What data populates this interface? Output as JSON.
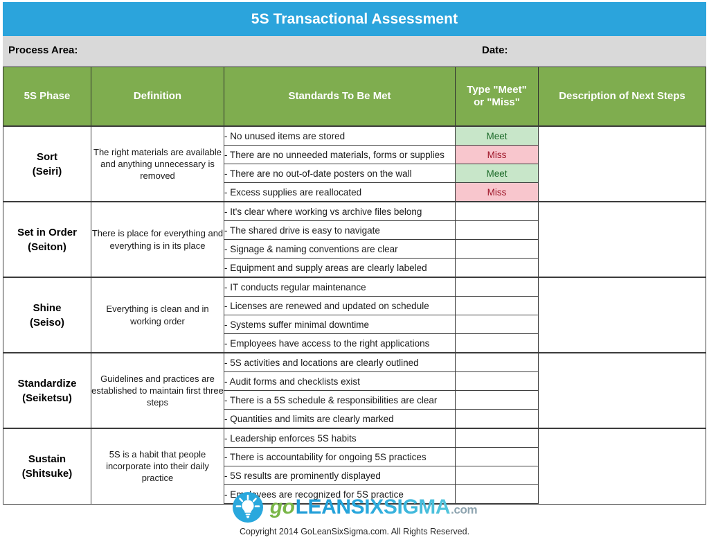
{
  "header": {
    "title": "5S Transactional Assessment"
  },
  "meta": {
    "process_area_label": "Process Area:",
    "process_area_value": "",
    "date_label": "Date:",
    "date_value": ""
  },
  "table": {
    "columns": [
      "5S Phase",
      "Definition",
      "Standards To Be Met",
      "Type \"Meet\" or \"Miss\"",
      "Description of Next Steps"
    ],
    "column_type_line1": "Type \"Meet\"",
    "column_type_line2": "or \"Miss\"",
    "sections": [
      {
        "phase_line1": "Sort",
        "phase_line2": "(Seiri)",
        "definition": "The right materials are available and anything unnecessary is removed",
        "rows": [
          {
            "standard": "- No unused items are stored",
            "type": "Meet",
            "next_steps": ""
          },
          {
            "standard": "- There are no unneeded materials, forms or supplies",
            "type": "Miss",
            "next_steps": ""
          },
          {
            "standard": "- There are no out-of-date posters on the wall",
            "type": "Meet",
            "next_steps": ""
          },
          {
            "standard": "- Excess supplies are reallocated",
            "type": "Miss",
            "next_steps": ""
          }
        ]
      },
      {
        "phase_line1": "Set in Order",
        "phase_line2": "(Seiton)",
        "definition": "There is place for everything and everything is in its place",
        "rows": [
          {
            "standard": "- It's clear where working vs archive files belong",
            "type": "",
            "next_steps": ""
          },
          {
            "standard": "- The shared drive is easy to navigate",
            "type": "",
            "next_steps": ""
          },
          {
            "standard": "- Signage & naming conventions are clear",
            "type": "",
            "next_steps": ""
          },
          {
            "standard": "- Equipment and supply areas are clearly labeled",
            "type": "",
            "next_steps": ""
          }
        ]
      },
      {
        "phase_line1": "Shine",
        "phase_line2": "(Seiso)",
        "definition": "Everything is clean and in working order",
        "rows": [
          {
            "standard": "- IT conducts regular maintenance",
            "type": "",
            "next_steps": ""
          },
          {
            "standard": "- Licenses are renewed and updated on schedule",
            "type": "",
            "next_steps": ""
          },
          {
            "standard": "- Systems suffer minimal downtime",
            "type": "",
            "next_steps": ""
          },
          {
            "standard": "- Employees have access to the right applications",
            "type": "",
            "next_steps": ""
          }
        ]
      },
      {
        "phase_line1": "Standardize",
        "phase_line2": "(Seiketsu)",
        "definition": "Guidelines and practices are established to maintain first three steps",
        "rows": [
          {
            "standard": "- 5S activities and locations are clearly outlined",
            "type": "",
            "next_steps": ""
          },
          {
            "standard": "- Audit forms and checklists exist",
            "type": "",
            "next_steps": ""
          },
          {
            "standard": "- There is a 5S schedule & responsibilities are clear",
            "type": "",
            "next_steps": ""
          },
          {
            "standard": "- Quantities and limits are clearly marked",
            "type": "",
            "next_steps": ""
          }
        ]
      },
      {
        "phase_line1": "Sustain",
        "phase_line2": "(Shitsuke)",
        "definition": "5S is a habit that people incorporate into their daily practice",
        "rows": [
          {
            "standard": "- Leadership enforces 5S habits",
            "type": "",
            "next_steps": ""
          },
          {
            "standard": "- There is accountability for ongoing 5S practices",
            "type": "",
            "next_steps": ""
          },
          {
            "standard": "- 5S results are prominently displayed",
            "type": "",
            "next_steps": ""
          },
          {
            "standard": "- Employees are recognized for 5S practice",
            "type": "",
            "next_steps": ""
          }
        ]
      }
    ]
  },
  "footer": {
    "logo_go": "go",
    "logo_lean": "LEANSIXSIGMA",
    "logo_com": ".com",
    "copyright": "Copyright 2014 GoLeanSixSigma.com. All Rights Reserved."
  },
  "colors": {
    "title_bar_blue": "#2ba4dc",
    "meta_gray": "#d9d9d9",
    "header_green": "#7fad4f",
    "meet_bg": "#c8e6c9",
    "meet_text": "#1d6b2a",
    "miss_bg": "#f8c6cd",
    "miss_text": "#9c1426",
    "logo_green": "#7ab648",
    "logo_blue": "#29a8dd"
  }
}
